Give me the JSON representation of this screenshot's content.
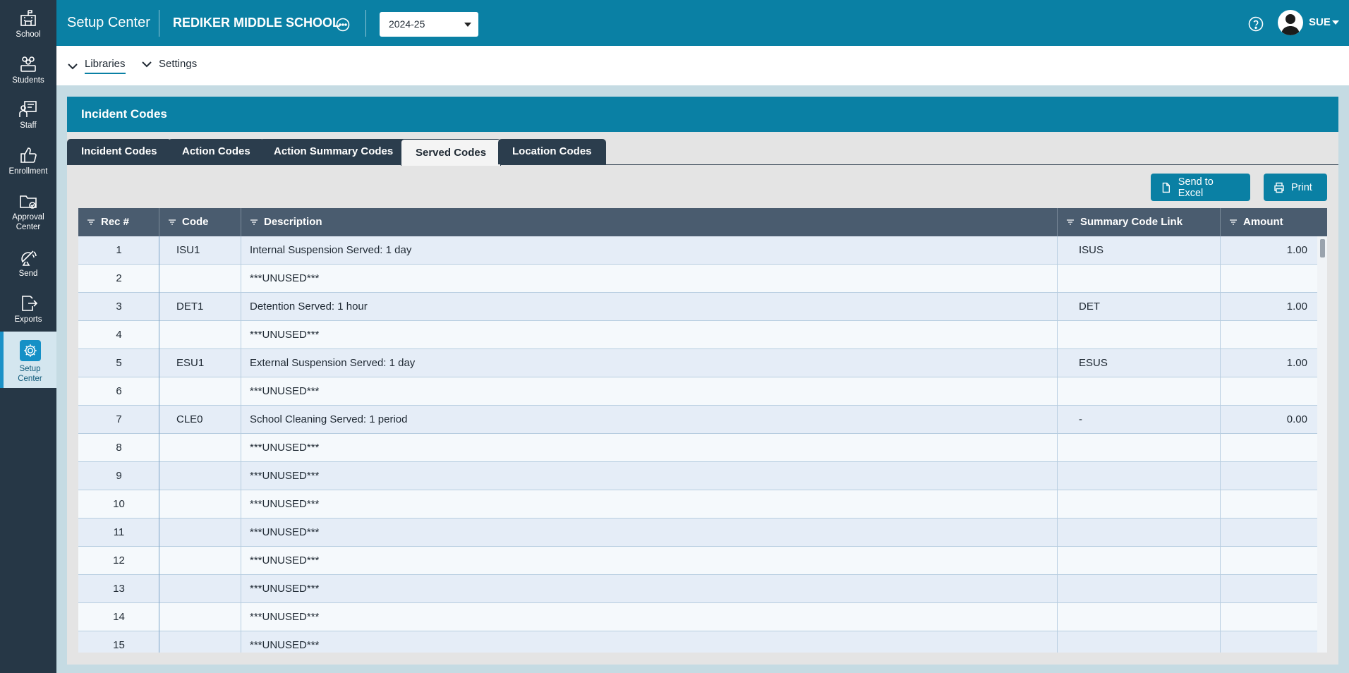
{
  "sidebar": {
    "items": [
      {
        "label": "School",
        "icon": "school-icon"
      },
      {
        "label": "Students",
        "icon": "students-icon"
      },
      {
        "label": "Staff",
        "icon": "staff-icon"
      },
      {
        "label": "Enrollment",
        "icon": "thumbs-up-icon"
      },
      {
        "label_line1": "Approval",
        "label_line2": "Center",
        "icon": "folder-check-icon"
      },
      {
        "label": "Send",
        "icon": "satellite-icon"
      },
      {
        "label": "Exports",
        "icon": "export-icon"
      },
      {
        "label_line1": "Setup",
        "label_line2": "Center",
        "icon": "gear-icon",
        "active": true
      }
    ]
  },
  "header": {
    "app_title": "Setup Center",
    "school_name": "REDIKER MIDDLE SCHOOL",
    "school_year": "2024-25",
    "user": "SUE"
  },
  "subnav": {
    "libraries": "Libraries",
    "settings": "Settings"
  },
  "panel": {
    "title": "Incident Codes",
    "tabs": [
      "Incident Codes",
      "Action Codes",
      "Action Summary Codes",
      "Served Codes",
      "Location Codes"
    ],
    "active_tab": "Served Codes",
    "send_to_excel": "Send to Excel",
    "print": "Print"
  },
  "table": {
    "columns": [
      "Rec #",
      "Code",
      "Description",
      "Summary Code Link",
      "Amount"
    ],
    "rows": [
      {
        "rec": "1",
        "code": "ISU1",
        "description": "Internal Suspension Served: 1 day",
        "summary": "ISUS",
        "amount": "1.00"
      },
      {
        "rec": "2",
        "code": "",
        "description": "***UNUSED***",
        "summary": "",
        "amount": ""
      },
      {
        "rec": "3",
        "code": "DET1",
        "description": "Detention Served: 1 hour",
        "summary": "DET",
        "amount": "1.00"
      },
      {
        "rec": "4",
        "code": "",
        "description": "***UNUSED***",
        "summary": "",
        "amount": ""
      },
      {
        "rec": "5",
        "code": "ESU1",
        "description": "External Suspension Served: 1 day",
        "summary": "ESUS",
        "amount": "1.00"
      },
      {
        "rec": "6",
        "code": "",
        "description": "***UNUSED***",
        "summary": "",
        "amount": ""
      },
      {
        "rec": "7",
        "code": "CLE0",
        "description": "School Cleaning Served: 1 period",
        "summary": "-",
        "amount": "0.00"
      },
      {
        "rec": "8",
        "code": "",
        "description": "***UNUSED***",
        "summary": "",
        "amount": ""
      },
      {
        "rec": "9",
        "code": "",
        "description": "***UNUSED***",
        "summary": "",
        "amount": ""
      },
      {
        "rec": "10",
        "code": "",
        "description": "***UNUSED***",
        "summary": "",
        "amount": ""
      },
      {
        "rec": "11",
        "code": "",
        "description": "***UNUSED***",
        "summary": "",
        "amount": ""
      },
      {
        "rec": "12",
        "code": "",
        "description": "***UNUSED***",
        "summary": "",
        "amount": ""
      },
      {
        "rec": "13",
        "code": "",
        "description": "***UNUSED***",
        "summary": "",
        "amount": ""
      },
      {
        "rec": "14",
        "code": "",
        "description": "***UNUSED***",
        "summary": "",
        "amount": ""
      },
      {
        "rec": "15",
        "code": "",
        "description": "***UNUSED***",
        "summary": "",
        "amount": ""
      }
    ]
  },
  "colors": {
    "brand": "#0a80a4",
    "sidebar": "#263746",
    "tab": "#2b3d4d",
    "table_header": "#4a5c6f"
  }
}
